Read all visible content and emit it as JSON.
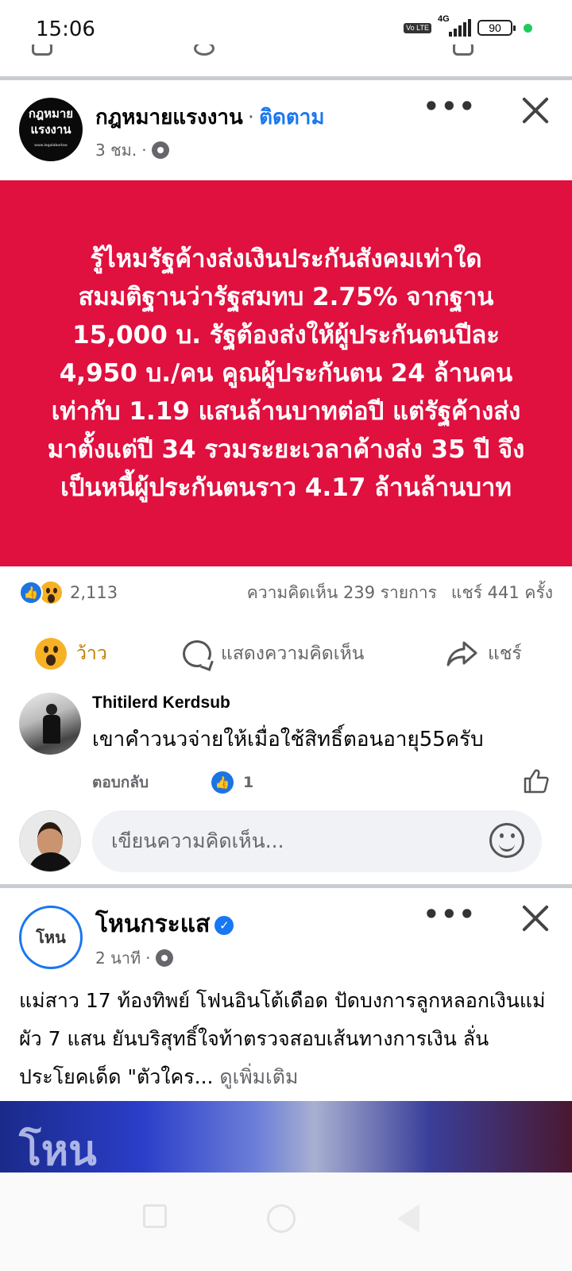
{
  "status_bar": {
    "time": "15:06",
    "volte": "Vo LTE",
    "network": "4G",
    "battery": "90"
  },
  "post1": {
    "page_name": "กฎหมายแรงงาน",
    "follow_label": "ติดตาม",
    "time": "3 ชม.",
    "avatar_text_line1": "กฎหมาย",
    "avatar_text_line2": "แรงงาน",
    "card_text": "รู้ไหมรัฐค้างส่งเงินประกันสังคมเท่าใด สมมติฐานว่ารัฐสมทบ 2.75% จากฐาน 15,000 บ. รัฐต้องส่งให้ผู้ประกันตนปีละ 4,950 บ./คน คูณผู้ประกันตน 24 ล้านคน เท่ากับ 1.19 แสนล้านบาทต่อปี แต่รัฐค้างส่งมาตั้งแต่ปี 34 รวมระยะเวลาค้างส่ง 35 ปี จึงเป็นหนี้ผู้ประกันตนราว 4.17 ล้านล้านบาท",
    "card_color": "#e0103f",
    "reaction_count": "2,113",
    "comments_count": "ความคิดเห็น 239 รายการ",
    "shares_count": "แชร์ 441 ครั้ง",
    "actions": {
      "reaction_label": "ว้าว",
      "comment_label": "แสดงความคิดเห็น",
      "share_label": "แชร์"
    },
    "comment": {
      "author": "Thitilerd Kerdsub",
      "text": "เขาคำวนวจ่ายให้เมื่อใช้สิทธิ์ตอนอายุ55ครับ",
      "reply_label": "ตอบกลับ",
      "like_count": "1"
    },
    "write_comment_placeholder": "เขียนความคิดเห็น..."
  },
  "post2": {
    "page_name": "โหนกระแส",
    "time": "2 นาที",
    "text": "แม่สาว 17 ท้องทิพย์ โฟนอินโต้เดือด ปัดบงการลูกหลอกเงินแม่ผัว 7 แสน ยันบริสุทธิ์ใจท้าตรวจสอบเส้นทางการเงิน ลั่นประโยคเด็ด \"ตัวใคร...",
    "see_more": "ดูเพิ่มเติม",
    "avatar_text": "โหน",
    "image_logo_text": "โหน"
  },
  "colors": {
    "accent": "#1877f2",
    "secondary_text": "#65676b",
    "wow": "#f7b125"
  }
}
